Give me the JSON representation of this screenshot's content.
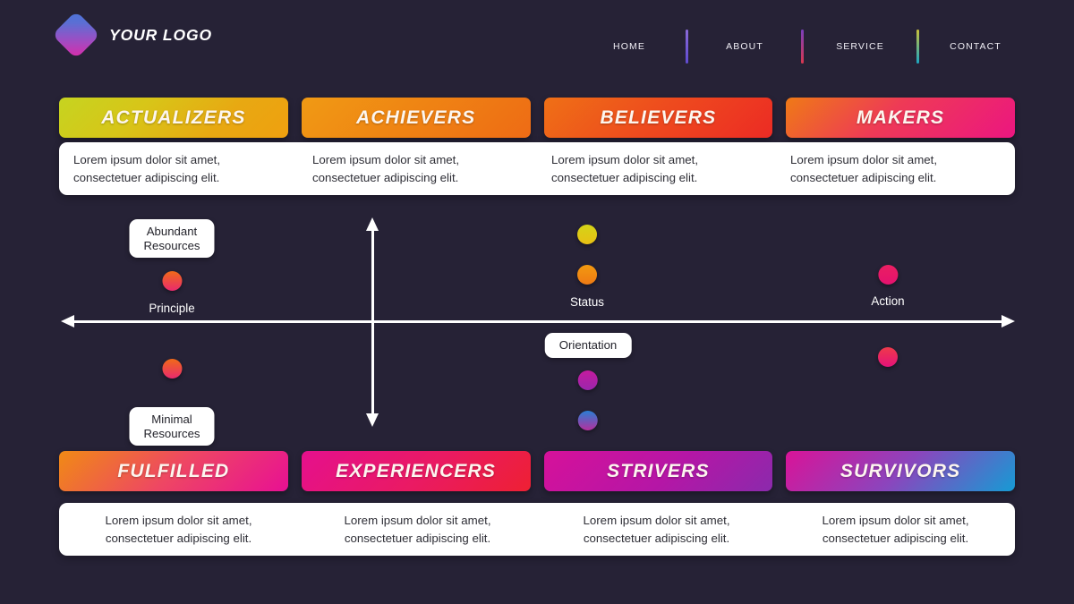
{
  "header": {
    "logo_text": "YOUR LOGO",
    "logo_icon": "diamond-logo-icon",
    "nav": [
      {
        "label": "HOME"
      },
      {
        "label": "ABOUT"
      },
      {
        "label": "SERVICE"
      },
      {
        "label": "CONTACT"
      }
    ]
  },
  "top_segments": [
    {
      "title": "ACTUALIZERS",
      "description": "Lorem ipsum dolor sit amet, consectetuer adipiscing elit.",
      "gradient": "linear-gradient(135deg, #c6d420 0%, #d8c518 35%, #e8a812 70%, #efa00f 100%)"
    },
    {
      "title": "ACHIEVERS",
      "description": "Lorem ipsum dolor sit amet, consectetuer adipiscing elit.",
      "gradient": "linear-gradient(135deg, #f09a14 0%, #ef8513 45%, #ee6b15 100%)"
    },
    {
      "title": "BELIEVERS",
      "description": "Lorem ipsum dolor sit amet, consectetuer adipiscing elit.",
      "gradient": "linear-gradient(135deg, #ef7016 0%, #ee4a1e 50%, #ec2b24 100%)"
    },
    {
      "title": "MAKERS",
      "description": "Lorem ipsum dolor sit amet, consectetuer adipiscing elit.",
      "gradient": "linear-gradient(135deg, #ef7a16 0%, #ee3a56 45%, #ec1680 100%)"
    }
  ],
  "bottom_segments": [
    {
      "title": "FULFILLED",
      "description": "Lorem ipsum dolor sit amet, consectetuer adipiscing elit.",
      "gradient": "linear-gradient(135deg, #f08a15 0%, #ee4763 50%, #e81093 100%)"
    },
    {
      "title": "EXPERIENCERS",
      "description": "Lorem ipsum dolor sit amet, consectetuer adipiscing elit.",
      "gradient": "linear-gradient(135deg, #e5108d 0%, #ea1a62 55%, #ee2033 100%)"
    },
    {
      "title": "STRIVERS",
      "description": "Lorem ipsum dolor sit amet, consectetuer adipiscing elit.",
      "gradient": "linear-gradient(135deg, #d6119a 0%, #b516a6 55%, #8b2aac 100%)"
    },
    {
      "title": "SURVIVORS",
      "description": "Lorem ipsum dolor sit amet, consectetuer adipiscing elit.",
      "gradient": "linear-gradient(135deg, #d91398 0%, #8b45bd 50%, #169bd4 100%)"
    }
  ],
  "matrix": {
    "chips": [
      {
        "id": "abundant-resources",
        "text": "Abundant\nResources"
      },
      {
        "id": "minimal-resources",
        "text": "Minimal\nResources"
      },
      {
        "id": "orientation",
        "text": "Orientation"
      }
    ],
    "axis_labels": [
      {
        "id": "principle",
        "text": "Principle"
      },
      {
        "id": "status",
        "text": "Status"
      },
      {
        "id": "action",
        "text": "Action"
      }
    ],
    "dots": [
      {
        "id": "principle-upper",
        "gradient": "linear-gradient(180deg, #f06a18 0%, #ea2a6e 100%)"
      },
      {
        "id": "status-upper-1",
        "gradient": "linear-gradient(180deg, #d4d418 0%, #e8c014 100%)"
      },
      {
        "id": "status-upper-2",
        "gradient": "linear-gradient(180deg, #f29a10 0%, #ef7a14 100%)"
      },
      {
        "id": "action-upper",
        "gradient": "linear-gradient(180deg, #ea1f62 0%, #e5126f 100%)"
      },
      {
        "id": "principle-lower",
        "gradient": "linear-gradient(180deg, #f06a18 0%, #ea2a6e 100%)"
      },
      {
        "id": "status-lower-1",
        "gradient": "linear-gradient(180deg, #c51b9e 0%, #9b26ad 100%)"
      },
      {
        "id": "status-lower-2",
        "gradient": "linear-gradient(180deg, #2a7ed4 0%, #b5309e 100%)"
      },
      {
        "id": "action-lower",
        "gradient": "linear-gradient(180deg, #ee3a4a 0%, #e5127a 100%)"
      }
    ]
  },
  "colors": {
    "background": "#262236",
    "panel": "#ffffff",
    "axis": "#ffffff",
    "text_dark": "#2e2e36"
  }
}
